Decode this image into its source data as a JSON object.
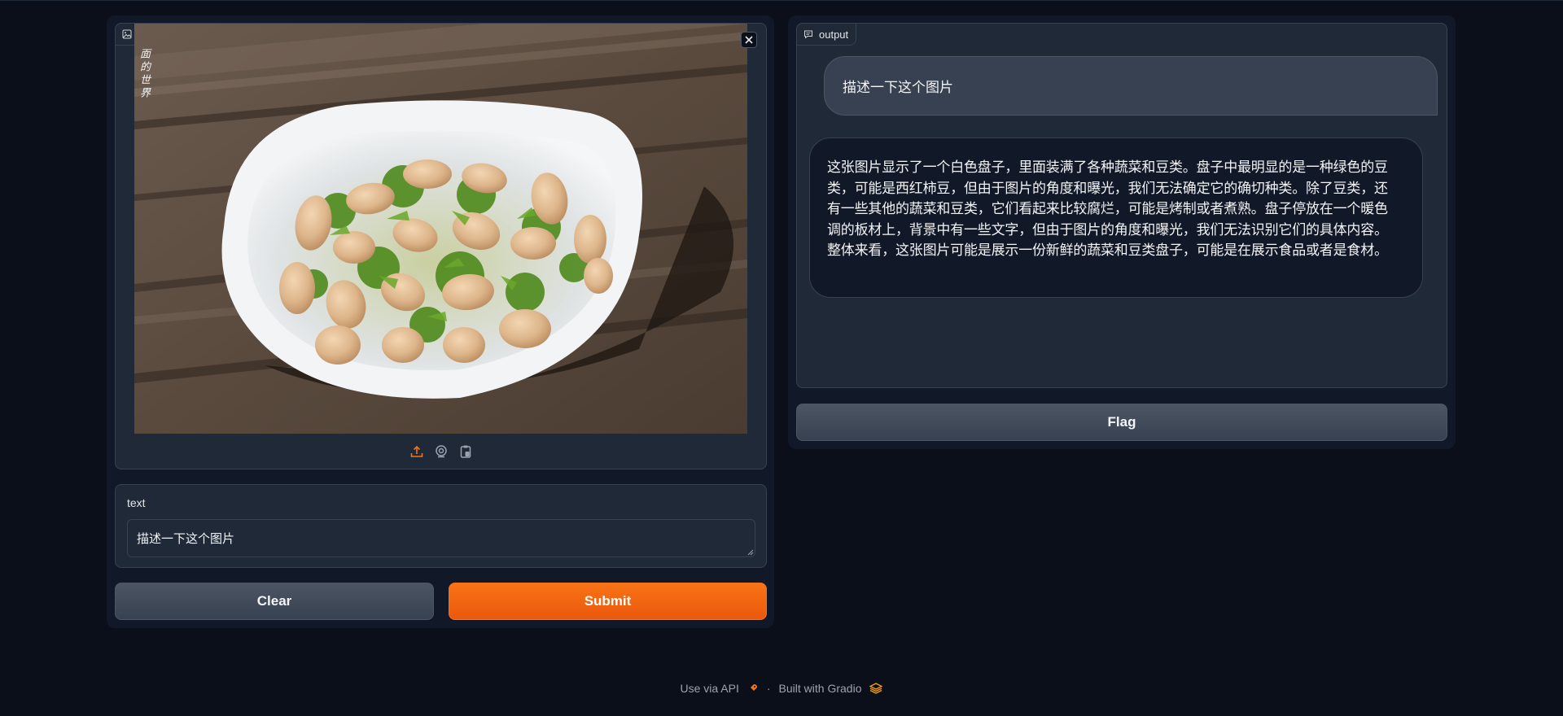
{
  "input_panel": {
    "image_block": {
      "label": "image",
      "label_icon": "image-icon",
      "photo_overlay_text": "面的世界",
      "toolbar": [
        {
          "name": "upload-icon",
          "color": "#f97316"
        },
        {
          "name": "webcam-icon",
          "color": "#9ca3af"
        },
        {
          "name": "clipboard-icon",
          "color": "#9ca3af"
        }
      ]
    },
    "text_block": {
      "label": "text",
      "value": "描述一下这个图片"
    },
    "buttons": {
      "clear_label": "Clear",
      "submit_label": "Submit"
    }
  },
  "output_panel": {
    "label": "output",
    "label_icon": "chat-icon",
    "messages": [
      {
        "role": "user",
        "text": "描述一下这个图片"
      },
      {
        "role": "bot",
        "text": "这张图片显示了一个白色盘子，里面装满了各种蔬菜和豆类。盘子中最明显的是一种绿色的豆类，可能是西红柿豆，但由于图片的角度和曝光，我们无法确定它的确切种类。除了豆类，还有一些其他的蔬菜和豆类，它们看起来比较腐烂，可能是烤制或者煮熟。盘子停放在一个暖色调的板材上，背景中有一些文字，但由于图片的角度和曝光，我们无法识别它们的具体内容。整体来看，这张图片可能是展示一份新鲜的蔬菜和豆类盘子，可能是在展示食品或者是食材。"
      }
    ],
    "flag_label": "Flag"
  },
  "footer": {
    "api_label": "Use via API",
    "separator": "·",
    "built_label": "Built with Gradio"
  },
  "colors": {
    "background": "#0b0f19",
    "panel": "#111827",
    "block": "#1f2937",
    "border": "#374151",
    "accent": "#f97316"
  }
}
